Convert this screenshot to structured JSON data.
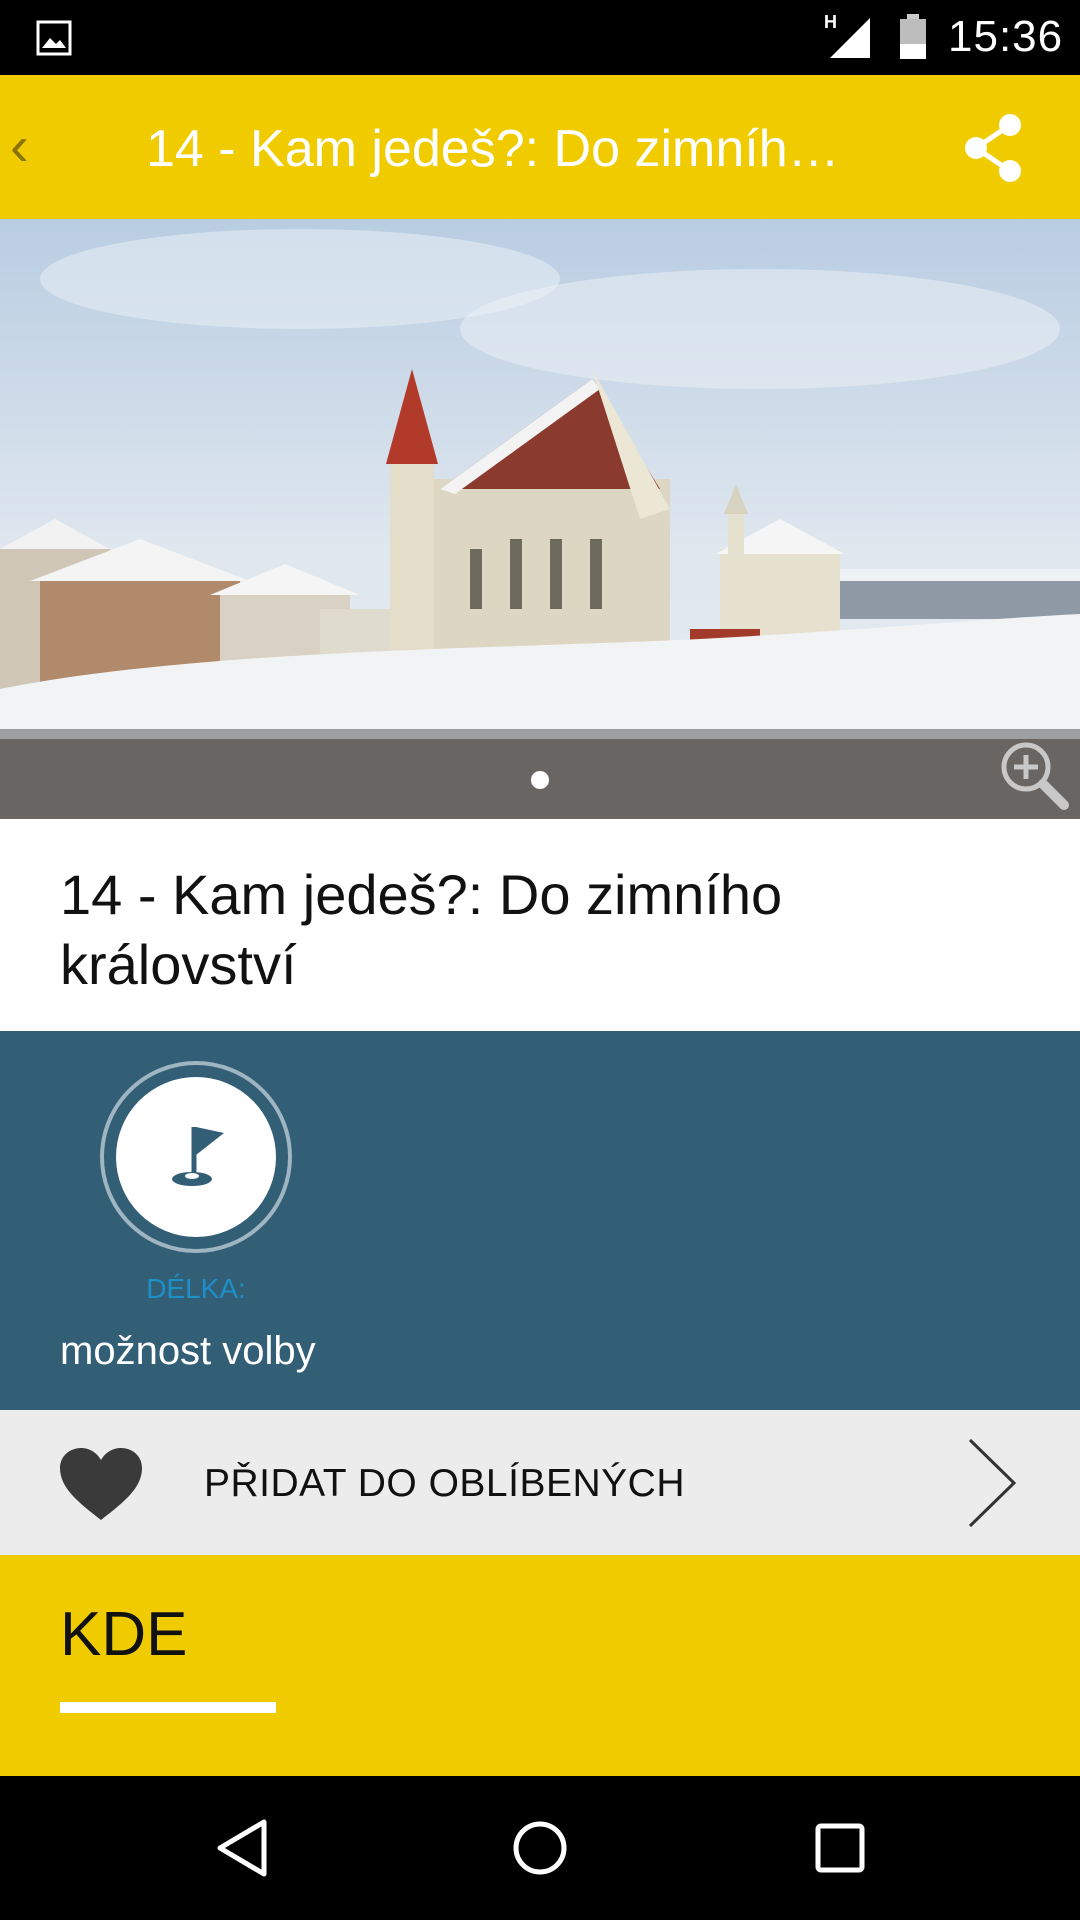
{
  "status_bar": {
    "network_type": "H",
    "time": "15:36",
    "icons": [
      "image-notification-icon",
      "signal-icon",
      "battery-icon"
    ]
  },
  "app_bar": {
    "back_icon": "back-chevron-icon",
    "title": "14 - Kam jedeš?: Do zimního…",
    "share_icon": "share-icon",
    "background_color": "#f0cb00"
  },
  "gallery": {
    "image_description_icon": "zoom-in-icon",
    "page_count": 1,
    "current_page": 1
  },
  "detail": {
    "title": "14 - Kam jedeš?: Do zimního království"
  },
  "info": {
    "badge_icon": "golf-flag-icon",
    "length_label": "DÉLKA:",
    "length_value": "možnost volby",
    "background_color": "#325e76"
  },
  "favorites": {
    "icon": "heart-icon",
    "label": "PŘIDAT DO OBLÍBENÝCH",
    "chevron_icon": "chevron-right-icon"
  },
  "location": {
    "heading": "KDE"
  },
  "nav_bar": {
    "back_icon": "nav-back-icon",
    "home_icon": "nav-home-icon",
    "recents_icon": "nav-recents-icon"
  }
}
